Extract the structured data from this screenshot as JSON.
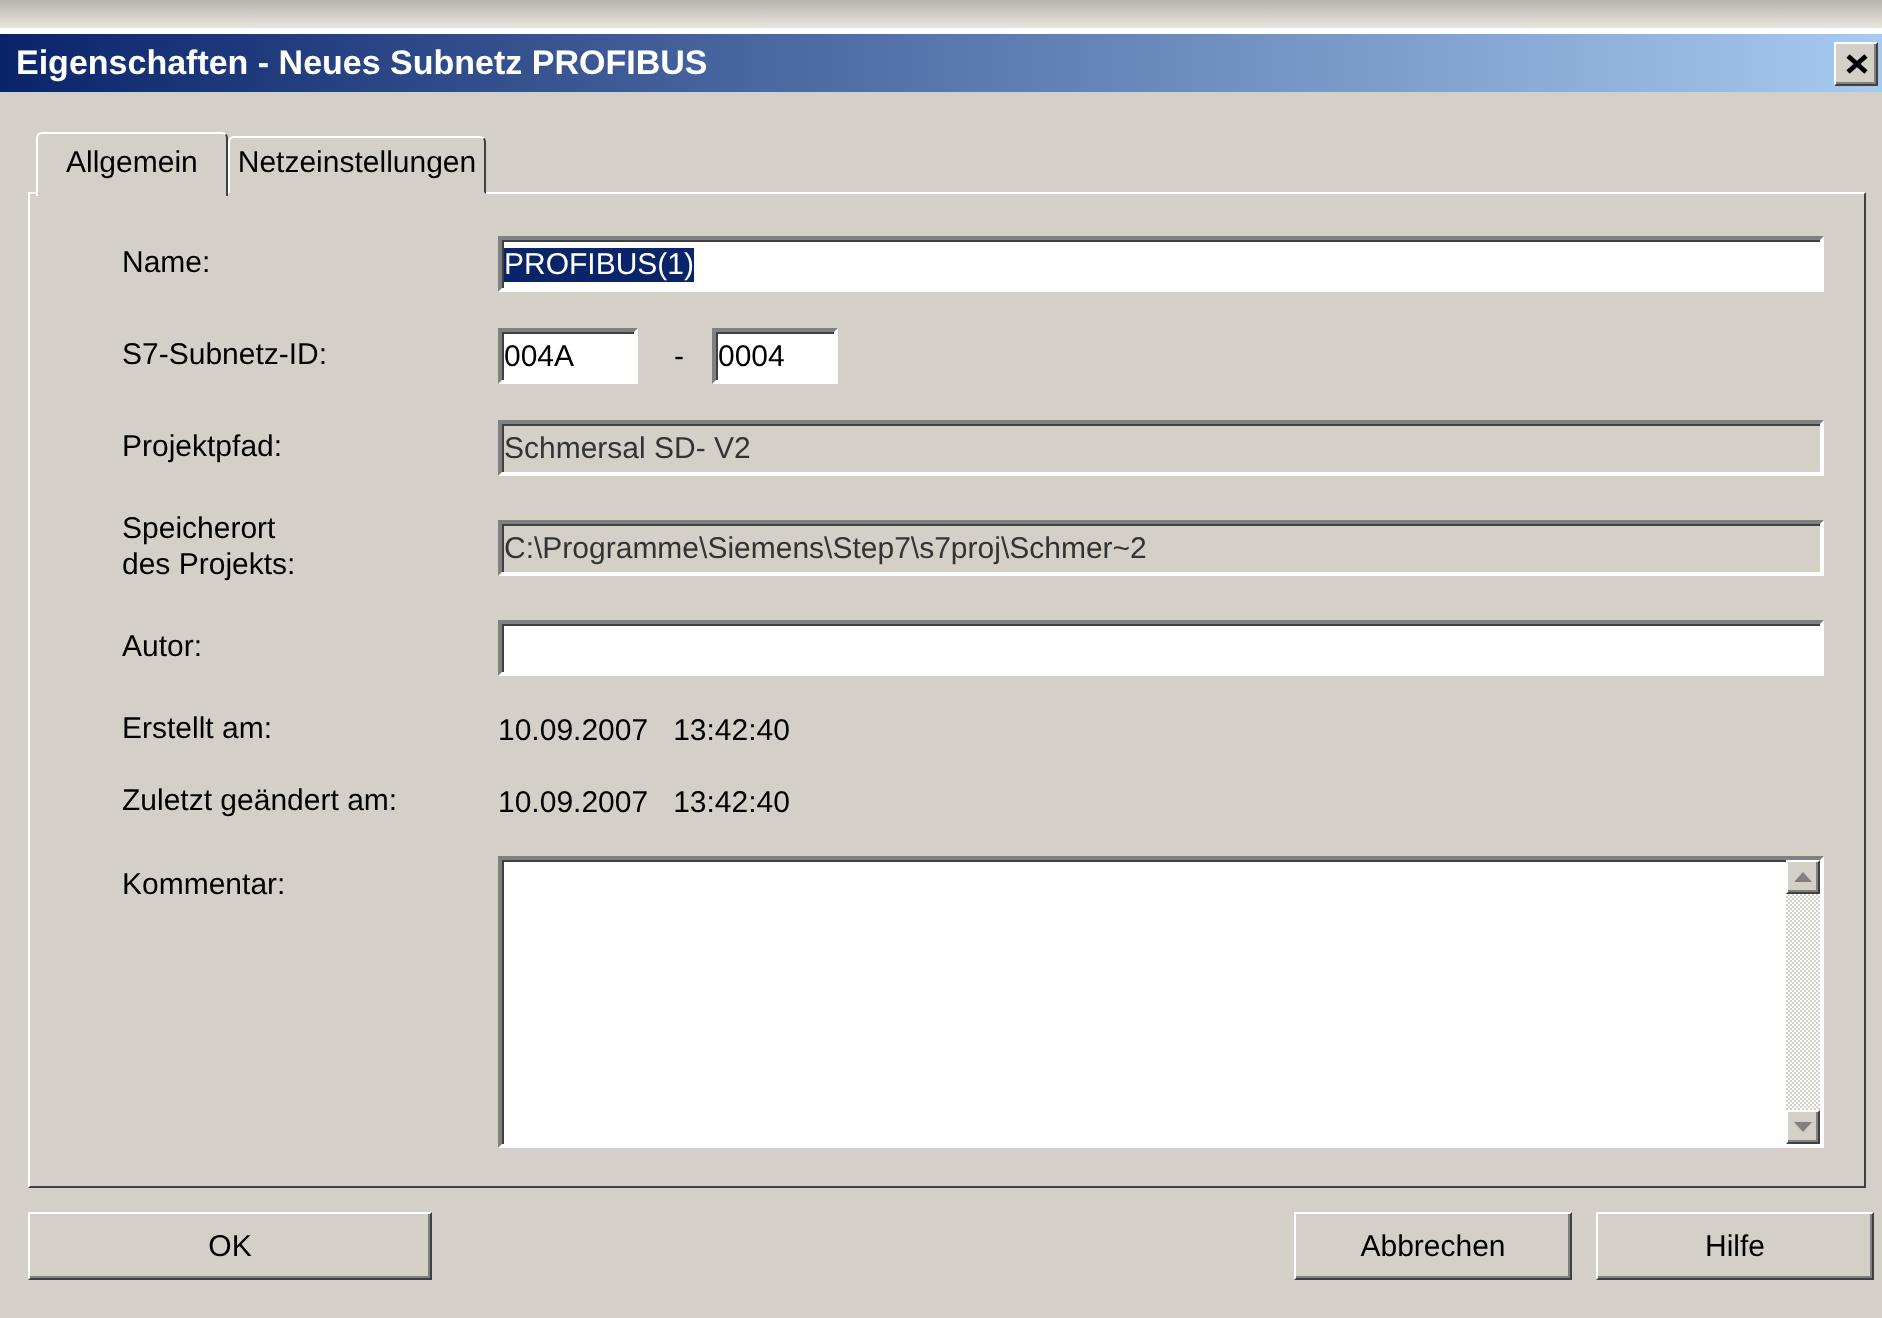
{
  "window": {
    "title": "Eigenschaften - Neues Subnetz PROFIBUS"
  },
  "tabs": [
    {
      "label": "Allgemein",
      "selected": true
    },
    {
      "label": "Netzeinstellungen",
      "selected": false
    }
  ],
  "rows": [
    {
      "kind": "text",
      "label": "Name:",
      "value": "PROFIBUS(1)",
      "text_selected": true,
      "disabled": false
    },
    {
      "kind": "id",
      "label": "S7-Subnetz-ID:",
      "value": "004A",
      "separator": "-",
      "value_2": "0004"
    },
    {
      "kind": "text",
      "label": "Projektpfad:",
      "value": "Schmersal SD- V2",
      "disabled": true
    },
    {
      "kind": "text",
      "label": "Speicherort\ndes Projekts:",
      "value": "C:\\Programme\\Siemens\\Step7\\s7proj\\Schmer~2",
      "disabled": true
    },
    {
      "kind": "text",
      "label": "Autor:",
      "value": "",
      "disabled": false
    },
    {
      "kind": "info",
      "label": "Erstellt am:",
      "value": "10.09.2007   13:42:40"
    },
    {
      "kind": "info",
      "label": "Zuletzt geändert am:",
      "value": "10.09.2007   13:42:40"
    },
    {
      "kind": "textarea",
      "label": "Kommentar:",
      "value": ""
    }
  ],
  "buttons": [
    {
      "label": "OK"
    },
    {
      "label": "Abbrechen"
    },
    {
      "label": "Hilfe"
    }
  ]
}
